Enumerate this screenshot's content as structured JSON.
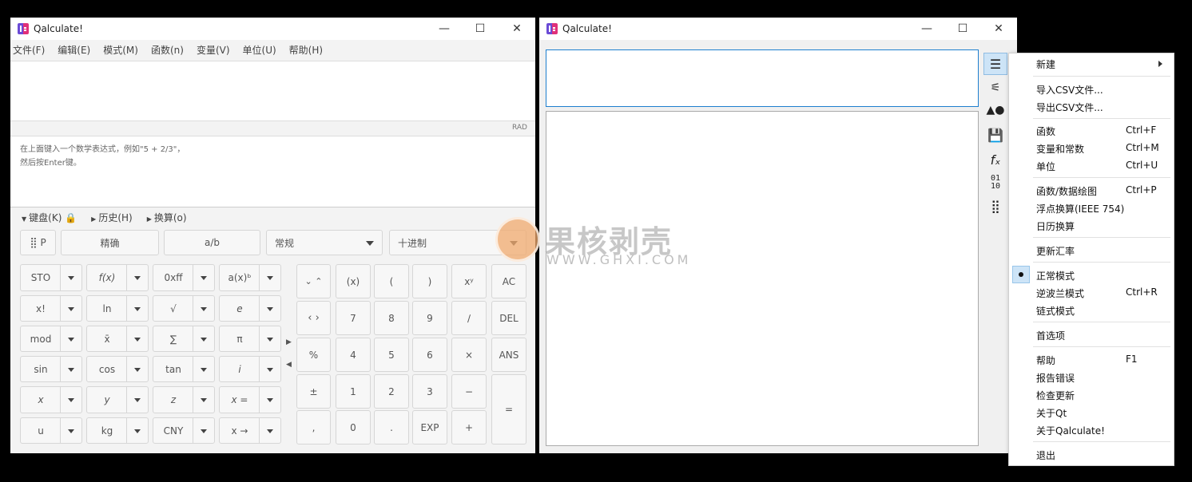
{
  "main_window": {
    "title": "Qalculate!",
    "menus": [
      "文件(F)",
      "编辑(E)",
      "模式(M)",
      "函数(n)",
      "变量(V)",
      "单位(U)",
      "帮助(H)"
    ],
    "angle_mode": "RAD",
    "hint_line1": "在上面键入一个数学表达式，例如\"5 + 2/3\"，",
    "hint_line2": "然后按Enter键。",
    "sections": {
      "keyboard": "键盘(K)",
      "history": "历史(H)",
      "convert": "换算(o)"
    },
    "top_row": {
      "p_label": "P",
      "exact": "精确",
      "fraction": "a∕b",
      "format": "常规",
      "base": "十进制"
    },
    "fn_keys": [
      [
        "STO",
        "f(x)",
        "0xff",
        "a(x)ᵇ"
      ],
      [
        "x!",
        "ln",
        "√",
        "e"
      ],
      [
        "mod",
        "x̄",
        "∑",
        "π"
      ],
      [
        "sin",
        "cos",
        "tan",
        "i"
      ],
      [
        "x",
        "y",
        "z",
        "x ="
      ],
      [
        "u",
        "kg",
        "CNY",
        "x →"
      ]
    ],
    "num_keys": {
      "r1": [
        "(x)",
        "(",
        ")",
        "xʸ",
        "AC"
      ],
      "r2": [
        "7",
        "8",
        "9",
        "∕",
        "DEL"
      ],
      "r3": [
        "%",
        "4",
        "5",
        "6",
        "×",
        "ANS"
      ],
      "r4": [
        "±",
        "1",
        "2",
        "3",
        "−",
        "="
      ],
      "r5": [
        ",",
        "0",
        ".",
        "EXP",
        "+"
      ]
    }
  },
  "second_window": {
    "title": "Qalculate!"
  },
  "context_menu": {
    "new": "新建",
    "import_csv": "导入CSV文件...",
    "export_csv": "导出CSV文件...",
    "functions": "函数",
    "functions_sc": "Ctrl+F",
    "variables": "变量和常数",
    "variables_sc": "Ctrl+M",
    "units": "单位",
    "units_sc": "Ctrl+U",
    "plot": "函数/数据绘图",
    "plot_sc": "Ctrl+P",
    "float": "浮点换算(IEEE 754)",
    "calendar": "日历换算",
    "rates": "更新汇率",
    "normal_mode": "正常模式",
    "rpn_mode": "逆波兰模式",
    "rpn_sc": "Ctrl+R",
    "chain_mode": "链式模式",
    "prefs": "首选项",
    "help": "帮助",
    "help_sc": "F1",
    "report": "报告错误",
    "check_updates": "检查更新",
    "about_qt": "关于Qt",
    "about": "关于Qalculate!",
    "quit": "退出"
  },
  "watermark": {
    "title": "果核剥壳",
    "subtitle": "WWW.GHXI.COM"
  }
}
